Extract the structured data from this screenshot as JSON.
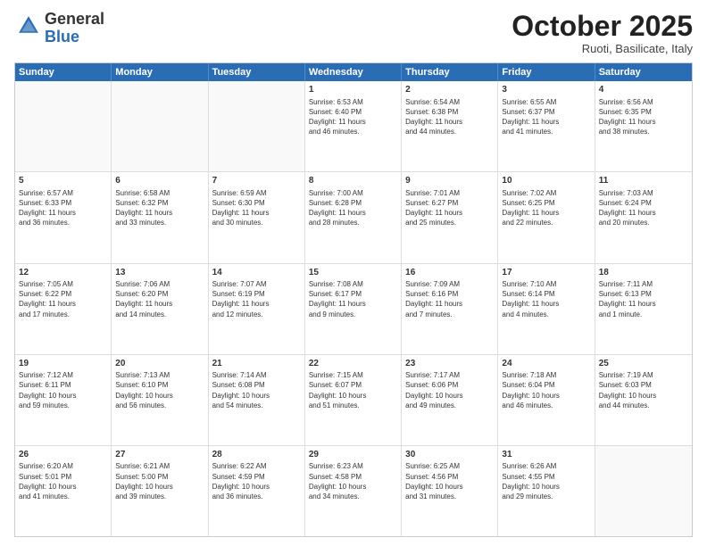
{
  "logo": {
    "general": "General",
    "blue": "Blue"
  },
  "title": "October 2025",
  "location": "Ruoti, Basilicate, Italy",
  "days_of_week": [
    "Sunday",
    "Monday",
    "Tuesday",
    "Wednesday",
    "Thursday",
    "Friday",
    "Saturday"
  ],
  "weeks": [
    [
      {
        "day": "",
        "info": ""
      },
      {
        "day": "",
        "info": ""
      },
      {
        "day": "",
        "info": ""
      },
      {
        "day": "1",
        "info": "Sunrise: 6:53 AM\nSunset: 6:40 PM\nDaylight: 11 hours\nand 46 minutes."
      },
      {
        "day": "2",
        "info": "Sunrise: 6:54 AM\nSunset: 6:38 PM\nDaylight: 11 hours\nand 44 minutes."
      },
      {
        "day": "3",
        "info": "Sunrise: 6:55 AM\nSunset: 6:37 PM\nDaylight: 11 hours\nand 41 minutes."
      },
      {
        "day": "4",
        "info": "Sunrise: 6:56 AM\nSunset: 6:35 PM\nDaylight: 11 hours\nand 38 minutes."
      }
    ],
    [
      {
        "day": "5",
        "info": "Sunrise: 6:57 AM\nSunset: 6:33 PM\nDaylight: 11 hours\nand 36 minutes."
      },
      {
        "day": "6",
        "info": "Sunrise: 6:58 AM\nSunset: 6:32 PM\nDaylight: 11 hours\nand 33 minutes."
      },
      {
        "day": "7",
        "info": "Sunrise: 6:59 AM\nSunset: 6:30 PM\nDaylight: 11 hours\nand 30 minutes."
      },
      {
        "day": "8",
        "info": "Sunrise: 7:00 AM\nSunset: 6:28 PM\nDaylight: 11 hours\nand 28 minutes."
      },
      {
        "day": "9",
        "info": "Sunrise: 7:01 AM\nSunset: 6:27 PM\nDaylight: 11 hours\nand 25 minutes."
      },
      {
        "day": "10",
        "info": "Sunrise: 7:02 AM\nSunset: 6:25 PM\nDaylight: 11 hours\nand 22 minutes."
      },
      {
        "day": "11",
        "info": "Sunrise: 7:03 AM\nSunset: 6:24 PM\nDaylight: 11 hours\nand 20 minutes."
      }
    ],
    [
      {
        "day": "12",
        "info": "Sunrise: 7:05 AM\nSunset: 6:22 PM\nDaylight: 11 hours\nand 17 minutes."
      },
      {
        "day": "13",
        "info": "Sunrise: 7:06 AM\nSunset: 6:20 PM\nDaylight: 11 hours\nand 14 minutes."
      },
      {
        "day": "14",
        "info": "Sunrise: 7:07 AM\nSunset: 6:19 PM\nDaylight: 11 hours\nand 12 minutes."
      },
      {
        "day": "15",
        "info": "Sunrise: 7:08 AM\nSunset: 6:17 PM\nDaylight: 11 hours\nand 9 minutes."
      },
      {
        "day": "16",
        "info": "Sunrise: 7:09 AM\nSunset: 6:16 PM\nDaylight: 11 hours\nand 7 minutes."
      },
      {
        "day": "17",
        "info": "Sunrise: 7:10 AM\nSunset: 6:14 PM\nDaylight: 11 hours\nand 4 minutes."
      },
      {
        "day": "18",
        "info": "Sunrise: 7:11 AM\nSunset: 6:13 PM\nDaylight: 11 hours\nand 1 minute."
      }
    ],
    [
      {
        "day": "19",
        "info": "Sunrise: 7:12 AM\nSunset: 6:11 PM\nDaylight: 10 hours\nand 59 minutes."
      },
      {
        "day": "20",
        "info": "Sunrise: 7:13 AM\nSunset: 6:10 PM\nDaylight: 10 hours\nand 56 minutes."
      },
      {
        "day": "21",
        "info": "Sunrise: 7:14 AM\nSunset: 6:08 PM\nDaylight: 10 hours\nand 54 minutes."
      },
      {
        "day": "22",
        "info": "Sunrise: 7:15 AM\nSunset: 6:07 PM\nDaylight: 10 hours\nand 51 minutes."
      },
      {
        "day": "23",
        "info": "Sunrise: 7:17 AM\nSunset: 6:06 PM\nDaylight: 10 hours\nand 49 minutes."
      },
      {
        "day": "24",
        "info": "Sunrise: 7:18 AM\nSunset: 6:04 PM\nDaylight: 10 hours\nand 46 minutes."
      },
      {
        "day": "25",
        "info": "Sunrise: 7:19 AM\nSunset: 6:03 PM\nDaylight: 10 hours\nand 44 minutes."
      }
    ],
    [
      {
        "day": "26",
        "info": "Sunrise: 6:20 AM\nSunset: 5:01 PM\nDaylight: 10 hours\nand 41 minutes."
      },
      {
        "day": "27",
        "info": "Sunrise: 6:21 AM\nSunset: 5:00 PM\nDaylight: 10 hours\nand 39 minutes."
      },
      {
        "day": "28",
        "info": "Sunrise: 6:22 AM\nSunset: 4:59 PM\nDaylight: 10 hours\nand 36 minutes."
      },
      {
        "day": "29",
        "info": "Sunrise: 6:23 AM\nSunset: 4:58 PM\nDaylight: 10 hours\nand 34 minutes."
      },
      {
        "day": "30",
        "info": "Sunrise: 6:25 AM\nSunset: 4:56 PM\nDaylight: 10 hours\nand 31 minutes."
      },
      {
        "day": "31",
        "info": "Sunrise: 6:26 AM\nSunset: 4:55 PM\nDaylight: 10 hours\nand 29 minutes."
      },
      {
        "day": "",
        "info": ""
      }
    ]
  ]
}
